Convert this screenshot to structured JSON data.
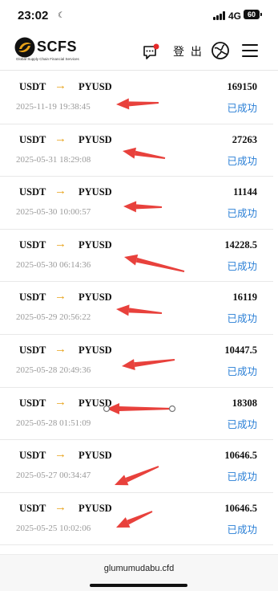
{
  "status_bar": {
    "time": "23:02",
    "network": "4G",
    "battery": "60"
  },
  "header": {
    "logo_text": "SCFS",
    "logo_subtitle": "Global Supply Chain Financial Services",
    "login_label": "登 出"
  },
  "transactions": [
    {
      "from": "USDT",
      "arrow": "→",
      "to": "PYUSD",
      "amount": "169150",
      "time": "2025-11-19 19:38:45",
      "status": "已成功"
    },
    {
      "from": "USDT",
      "arrow": "→",
      "to": "PYUSD",
      "amount": "27263",
      "time": "2025-05-31 18:29:08",
      "status": "已成功"
    },
    {
      "from": "USDT",
      "arrow": "→",
      "to": "PYUSD",
      "amount": "11144",
      "time": "2025-05-30 10:00:57",
      "status": "已成功"
    },
    {
      "from": "USDT",
      "arrow": "→",
      "to": "PYUSD",
      "amount": "14228.5",
      "time": "2025-05-30 06:14:36",
      "status": "已成功"
    },
    {
      "from": "USDT",
      "arrow": "→",
      "to": "PYUSD",
      "amount": "16119",
      "time": "2025-05-29 20:56:22",
      "status": "已成功"
    },
    {
      "from": "USDT",
      "arrow": "→",
      "to": "PYUSD",
      "amount": "10447.5",
      "time": "2025-05-28 20:49:36",
      "status": "已成功"
    },
    {
      "from": "USDT",
      "arrow": "→",
      "to": "PYUSD",
      "amount": "18308",
      "time": "2025-05-28 01:51:09",
      "status": "已成功"
    },
    {
      "from": "USDT",
      "arrow": "→",
      "to": "PYUSD",
      "amount": "10646.5",
      "time": "2025-05-27 00:34:47",
      "status": "已成功"
    },
    {
      "from": "USDT",
      "arrow": "→",
      "to": "PYUSD",
      "amount": "10646.5",
      "time": "2025-05-25 10:02:06",
      "status": "已成功"
    }
  ],
  "url_bar": {
    "url": "glumumudabu.cfd"
  },
  "colors": {
    "status_blue": "#2a7fd6",
    "arrow_orange": "#e8a21a",
    "annotation_red": "#e8413c"
  },
  "icons": [
    "logo-icon",
    "chat-icon",
    "language-icon",
    "menu-icon",
    "right-arrow-icon",
    "annotation-arrow-icon"
  ]
}
